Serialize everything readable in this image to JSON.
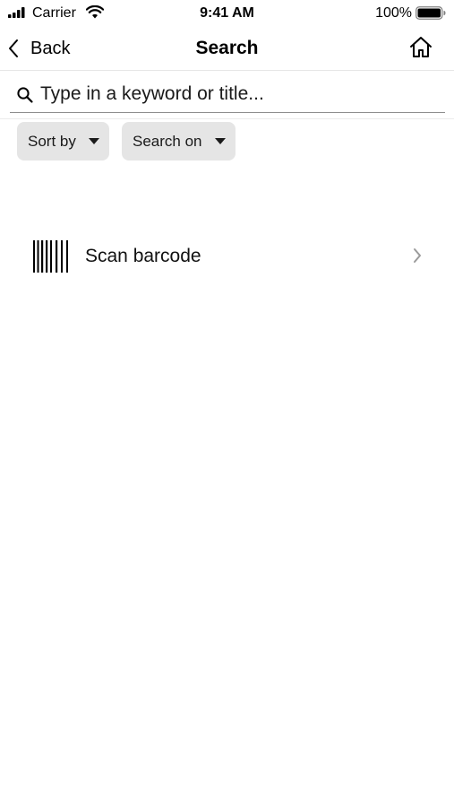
{
  "status_bar": {
    "carrier": "Carrier",
    "time": "9:41 AM",
    "battery": "100%"
  },
  "nav": {
    "back_label": "Back",
    "title": "Search"
  },
  "search": {
    "placeholder": "Type in a keyword or title..."
  },
  "filters": {
    "sort_label": "Sort by",
    "search_on_label": "Search on"
  },
  "scan": {
    "label": "Scan barcode"
  },
  "icons": {
    "signal": "signal-icon",
    "wifi": "wifi-icon",
    "battery": "battery-icon",
    "back": "chevron-left-icon",
    "home": "home-icon",
    "search": "search-icon",
    "dropdown": "caret-down-icon",
    "barcode": "barcode-icon",
    "chevron": "chevron-right-icon"
  },
  "colors": {
    "filter_button_bg": "#e5e5e5",
    "search_underline": "#8e8e8e",
    "chevron": "#9b9b9b"
  }
}
